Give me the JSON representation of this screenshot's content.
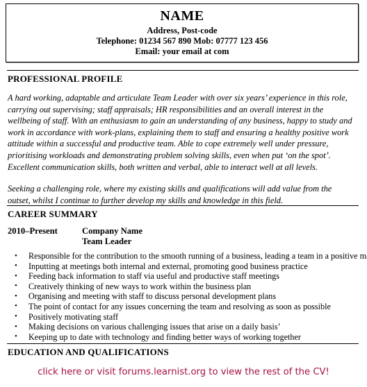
{
  "document": {
    "type": "cv-resume",
    "accent_color": "#a4123f",
    "text_color": "#000000",
    "background_color": "#ffffff"
  },
  "header": {
    "name": "NAME",
    "address": "Address, Post-code",
    "telephone": "Telephone: 01234 567 890 Mob: 07777 123 456",
    "email": "Email: your email at com"
  },
  "sections": {
    "profile": {
      "heading": "PROFESSIONAL PROFILE",
      "paragraphs": [
        "A hard working, adaptable and articulate Team Leader with over six years’ experience in this role, carrying out supervising; staff appraisals; HR responsibilities and an overall interest in the wellbeing of staff.  With an enthusiasm to gain an understanding of any business, happy to study and work in accordance with work-plans, explaining them to staff and ensuring a healthy positive work attitude within a successful and productive team.  Able to cope extremely well under pressure, prioritising workloads and demonstrating problem solving skills, even when put ‘on the spot’.  Excellent communication skills, both written and verbal, able to interact well at all levels.",
        "Seeking a challenging role, where my existing skills and qualifications will add value from the outset, whilst I continue to further develop my skills and knowledge in this field."
      ]
    },
    "career": {
      "heading": "CAREER SUMMARY",
      "entry": {
        "dates": "2010–Present",
        "company": "Company Name",
        "job_title": "Team Leader"
      },
      "bullet_glyph": "•",
      "duties": [
        "Responsible for the contribution to the smooth running of a business, leading a team in a positive manner",
        "Inputting at meetings both internal and external, promoting good business practice",
        "Feeding back information to staff via useful and productive staff meetings",
        "Creatively thinking of new ways to work within the business plan",
        "Organising and meeting with staff to discuss personal development plans",
        "The point of contact for any issues concerning the team and resolving as soon as possible",
        "Positively motivating staff",
        "Making decisions on various challenging issues that arise on a daily basis’",
        "Keeping up to date with technology and finding better ways of working together"
      ]
    },
    "education": {
      "heading": "EDUCATION AND QUALIFICATIONS"
    }
  },
  "footer": {
    "cta_text": "click here or visit forums.learnist.org to view the rest of the CV!"
  }
}
